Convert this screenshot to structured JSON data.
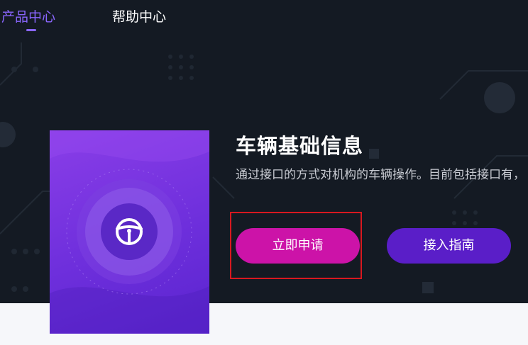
{
  "nav": {
    "items": [
      {
        "label": "产品中心",
        "active": true
      },
      {
        "label": "帮助中心",
        "active": false
      }
    ],
    "active_color": "#8a66ff"
  },
  "product": {
    "title": "车辆基础信息",
    "description": "通过接口的方式对机构的车辆操作。目前包括接口有，",
    "icon": "steering-wheel-icon",
    "apply_label": "立即申请",
    "guide_label": "接入指南"
  },
  "colors": {
    "hero_background": "#141a23",
    "apply_button": "#cc13a8",
    "guide_button": "#5a1ec8",
    "card_gradient_start": "#8a3ee8",
    "card_gradient_end": "#5a24cf",
    "highlight_border": "#d8181f"
  }
}
